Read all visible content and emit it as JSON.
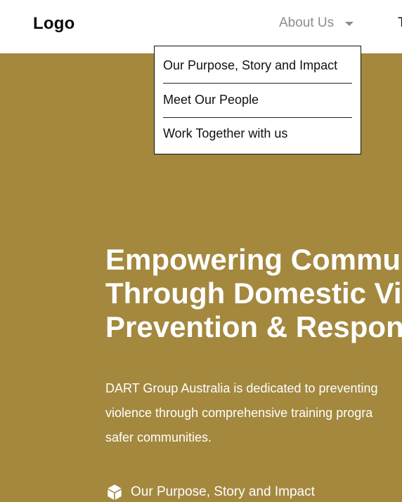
{
  "header": {
    "logo": "Logo",
    "nav": {
      "about_label": "About Us",
      "next_label_partial": "T"
    }
  },
  "dropdown": {
    "items": [
      {
        "label": "Our Purpose, Story and Impact"
      },
      {
        "label": "Meet Our People"
      },
      {
        "label": "Work Together with us"
      }
    ]
  },
  "hero": {
    "title_lines": [
      "Empowering Commu",
      "Through Domestic Vi",
      "Prevention & Respon"
    ],
    "description_lines": [
      "DART Group Australia is dedicated to preventing",
      "violence through comprehensive training progra",
      "safer communities."
    ],
    "link": {
      "icon": "box-icon",
      "label": "Our Purpose, Story and Impact"
    }
  },
  "colors": {
    "hero_background": "#a3883e",
    "header_background": "#ffffff",
    "nav_muted": "#8d8d8d"
  }
}
